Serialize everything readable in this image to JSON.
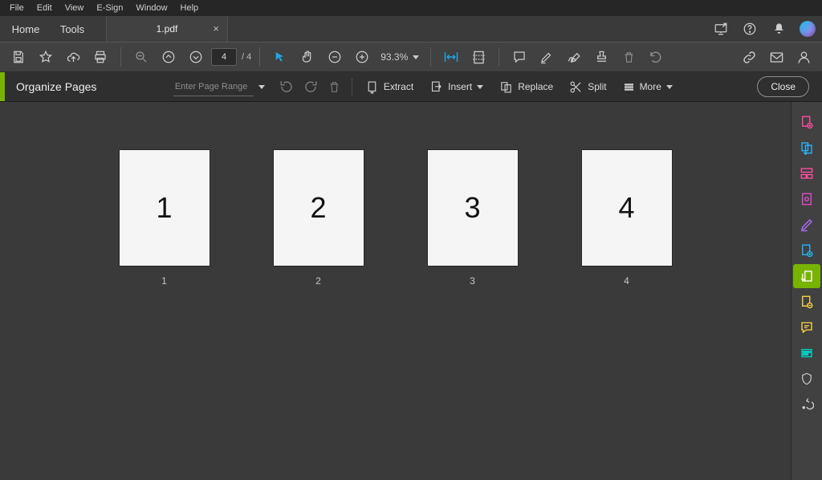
{
  "menu": {
    "items": [
      "File",
      "Edit",
      "View",
      "E-Sign",
      "Window",
      "Help"
    ]
  },
  "tabs": {
    "home": "Home",
    "tools": "Tools",
    "doc": "1.pdf"
  },
  "toolbar": {
    "page_current": "4",
    "page_total": "/ 4",
    "zoom": "93.3%"
  },
  "organize": {
    "title": "Organize Pages",
    "range_placeholder": "Enter Page Range",
    "extract": "Extract",
    "insert": "Insert",
    "replace": "Replace",
    "split": "Split",
    "more": "More",
    "close": "Close"
  },
  "pages": [
    {
      "display": "1",
      "label": "1"
    },
    {
      "display": "2",
      "label": "2"
    },
    {
      "display": "3",
      "label": "3"
    },
    {
      "display": "4",
      "label": "4"
    }
  ],
  "icons": {
    "colors": {
      "pink": "#ff4fa3",
      "blue": "#29b6ff",
      "purple": "#b06cff",
      "yellow": "#ffd54a",
      "cyan": "#00d2c7",
      "green": "#7cc900",
      "orange": "#ff9f43",
      "lightgray": "#cfcfcf"
    }
  }
}
